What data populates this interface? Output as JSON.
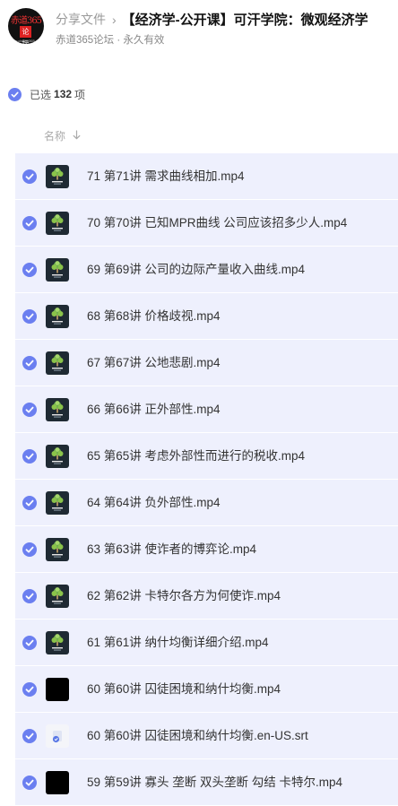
{
  "header": {
    "logo_text": "赤道365",
    "logo_seal": "论坛",
    "logo_small": "www.chidao365.com",
    "breadcrumb": "分享文件",
    "breadcrumb_sep": "›",
    "folder_title": "【经济学-公开课】可汗学院：微观经济学",
    "sharer": "赤道365论坛",
    "validity": "· 永久有效"
  },
  "selection": {
    "prefix": "已选",
    "count": "132",
    "suffix": "项"
  },
  "list_header": {
    "name_label": "名称",
    "sort_icon": "arrow-down-icon"
  },
  "accent_color": "#6b7ff0",
  "files": [
    {
      "name": "71 第71讲 需求曲线相加.mp4",
      "thumb": "video-tree"
    },
    {
      "name": "70 第70讲 已知MPR曲线 公司应该招多少人.mp4",
      "thumb": "video-tree"
    },
    {
      "name": "69 第69讲 公司的边际产量收入曲线.mp4",
      "thumb": "video-tree"
    },
    {
      "name": "68 第68讲 价格歧视.mp4",
      "thumb": "video-tree"
    },
    {
      "name": "67 第67讲 公地悲剧.mp4",
      "thumb": "video-tree"
    },
    {
      "name": "66 第66讲 正外部性.mp4",
      "thumb": "video-tree"
    },
    {
      "name": "65 第65讲 考虑外部性而进行的税收.mp4",
      "thumb": "video-tree"
    },
    {
      "name": "64 第64讲 负外部性.mp4",
      "thumb": "video-tree"
    },
    {
      "name": "63 第63讲 使诈者的博弈论.mp4",
      "thumb": "video-tree"
    },
    {
      "name": "62 第62讲 卡特尔各方为何使诈.mp4",
      "thumb": "video-tree"
    },
    {
      "name": "61 第61讲 纳什均衡详细介绍.mp4",
      "thumb": "video-tree"
    },
    {
      "name": "60 第60讲 囚徒困境和纳什均衡.mp4",
      "thumb": "video-black"
    },
    {
      "name": "60 第60讲 囚徒困境和纳什均衡.en-US.srt",
      "thumb": "subtitle-file"
    },
    {
      "name": "59 第59讲 寡头 垄断 双头垄断 勾结 卡特尔.mp4",
      "thumb": "video-black"
    }
  ]
}
